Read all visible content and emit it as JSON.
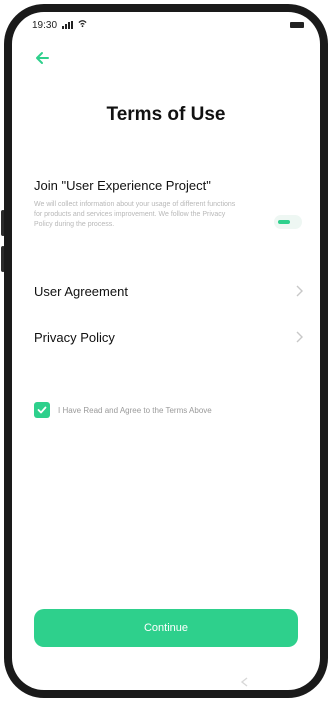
{
  "status_bar": {
    "time": "19:30",
    "wifi_icon": "wifi-icon",
    "battery_icon": "battery-icon"
  },
  "header": {
    "back_icon": "back-arrow-icon",
    "title": "Terms of Use"
  },
  "join": {
    "title": "Join \"User Experience Project\"",
    "description": "We will collect information about your usage of different functions for products and services improvement. We follow the Privacy Policy during the process.",
    "toggle_state": "off"
  },
  "rows": [
    {
      "label": "User Agreement"
    },
    {
      "label": "Privacy Policy"
    }
  ],
  "agreement": {
    "checked": true,
    "label": "I Have Read and Agree to the Terms Above"
  },
  "footer": {
    "continue_label": "Continue"
  },
  "colors": {
    "accent": "#2ed08c",
    "text_primary": "#111111",
    "text_secondary": "#b8b8b8"
  }
}
